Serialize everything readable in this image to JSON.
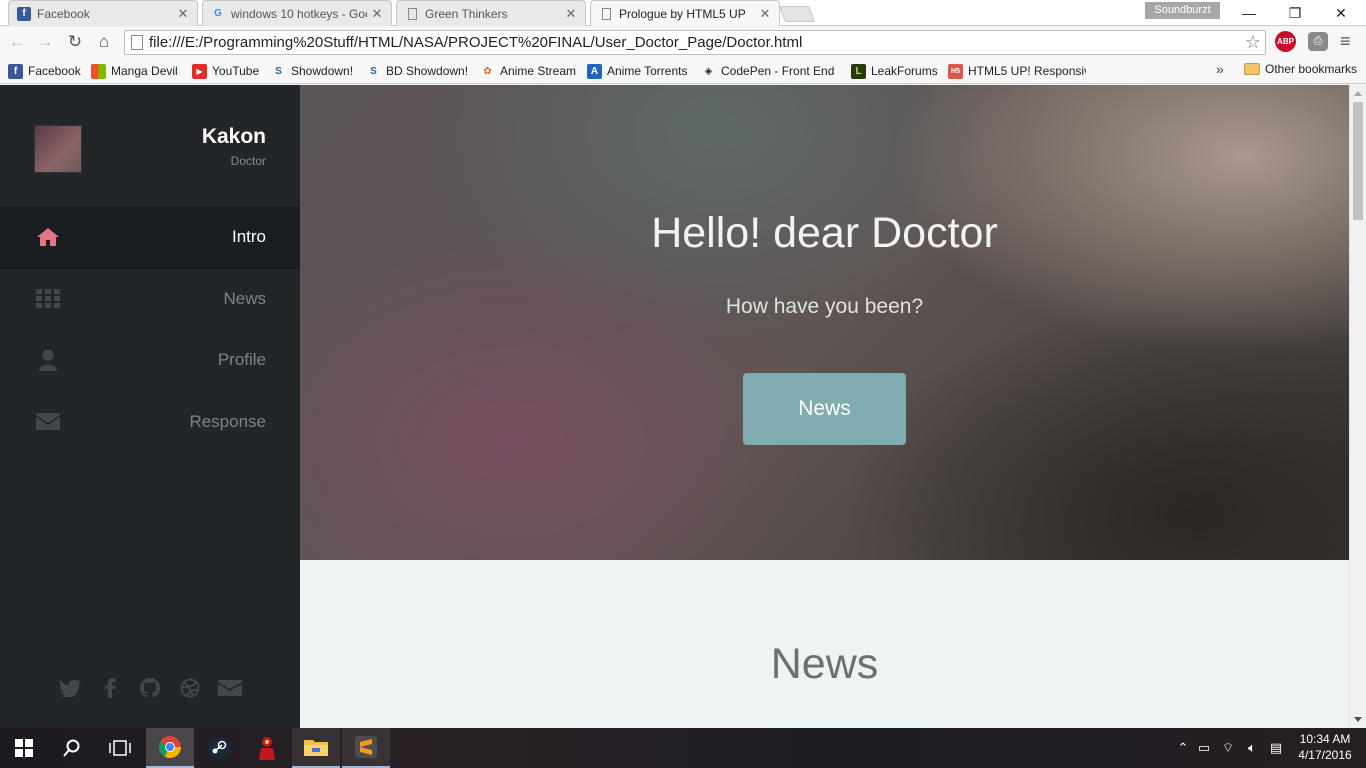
{
  "browser": {
    "tabs": [
      {
        "label": "Facebook",
        "icon": "facebook-icon",
        "active": false
      },
      {
        "label": "windows 10 hotkeys - Goo",
        "icon": "google-icon",
        "active": false
      },
      {
        "label": "Green Thinkers",
        "icon": "page-icon",
        "active": false
      },
      {
        "label": "Prologue by HTML5 UP",
        "icon": "page-icon",
        "active": true
      }
    ],
    "profile_name": "Soundburzt",
    "url": "file:///E:/Programming%20Stuff/HTML/NASA/PROJECT%20FINAL/User_Doctor_Page/Doctor.html",
    "abp_label": "ABP",
    "bookmarks": [
      {
        "label": "Facebook",
        "icon": "facebook-icon",
        "color": "#3b5998",
        "glyph": "f"
      },
      {
        "label": "Manga Devil",
        "icon": "windows-tiles-icon",
        "color": "#f25022",
        "glyph": ""
      },
      {
        "label": "YouTube",
        "icon": "youtube-icon",
        "color": "#e52d27",
        "glyph": "▶"
      },
      {
        "label": "Showdown!",
        "icon": "showdown-icon",
        "color": "#2b5fae",
        "glyph": "S"
      },
      {
        "label": "BD Showdown!",
        "icon": "showdown-icon",
        "color": "#2b5fae",
        "glyph": "S"
      },
      {
        "label": "Anime Stream",
        "icon": "anime-stream-icon",
        "color": "#d86d2a",
        "glyph": "✿"
      },
      {
        "label": "Anime Torrents",
        "icon": "anime-torrents-icon",
        "color": "#1e66c2",
        "glyph": "A"
      },
      {
        "label": "CodePen - Front End",
        "icon": "codepen-icon",
        "color": "#222222",
        "glyph": "◈"
      },
      {
        "label": "LeakForums",
        "icon": "leakforums-icon",
        "color": "#2a3a10",
        "glyph": "L"
      },
      {
        "label": "HTML5 UP! Responsiv",
        "icon": "html5up-icon",
        "color": "#e0574a",
        "glyph": "H5"
      }
    ],
    "bookmarks_more": "»",
    "other_bookmarks": "Other bookmarks"
  },
  "site": {
    "user": {
      "name": "Kakon",
      "role": "Doctor"
    },
    "nav": [
      {
        "label": "Intro",
        "icon": "home-icon",
        "active": true
      },
      {
        "label": "News",
        "icon": "grid-icon",
        "active": false
      },
      {
        "label": "Profile",
        "icon": "user-icon",
        "active": false
      },
      {
        "label": "Response",
        "icon": "envelope-icon",
        "active": false
      }
    ],
    "social": [
      "twitter-icon",
      "facebook-icon",
      "github-icon",
      "dribbble-icon",
      "envelope-icon"
    ],
    "hero": {
      "title": "Hello! dear Doctor",
      "subtitle": "How have you been?",
      "button": "News"
    },
    "news_heading": "News",
    "colors": {
      "sidebar": "#222629",
      "accent": "#e27689",
      "button": "#7fadaf",
      "section": "#eef3f3"
    }
  },
  "taskbar": {
    "apps": [
      "start-icon",
      "search-icon",
      "task-view-icon",
      "chrome-icon",
      "steam-icon",
      "app-red-icon",
      "file-explorer-icon",
      "sublime-text-icon"
    ],
    "time": "10:34 AM",
    "date": "4/17/2016"
  }
}
